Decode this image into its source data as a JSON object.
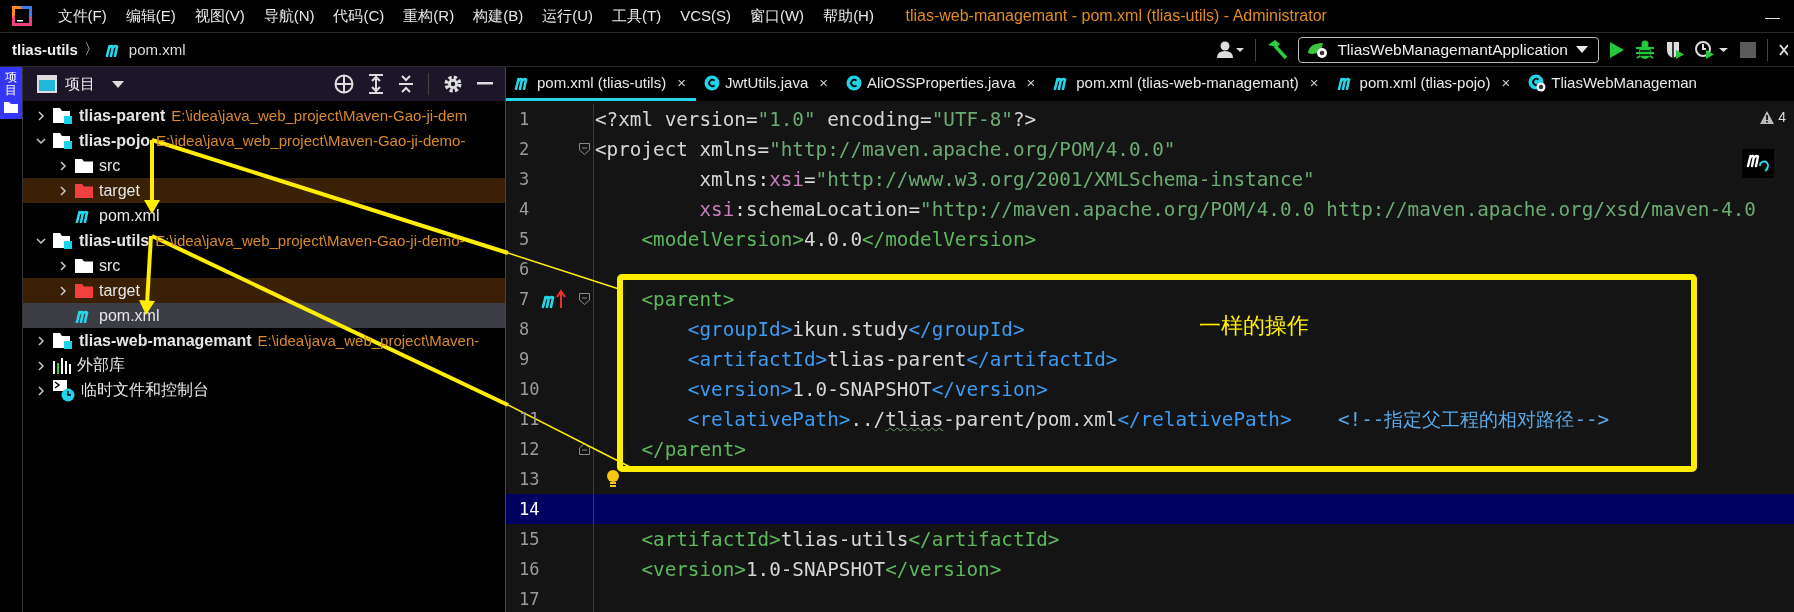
{
  "title_bar": {
    "menus": [
      "文件(F)",
      "编辑(E)",
      "视图(V)",
      "导航(N)",
      "代码(C)",
      "重构(R)",
      "构建(B)",
      "运行(U)",
      "工具(T)",
      "VCS(S)",
      "窗口(W)",
      "帮助(H)"
    ],
    "title": "tlias-web-managemant - pom.xml (tlias-utils) - Administrator",
    "minimize": "—"
  },
  "breadcrumb": {
    "project": "tlias-utils",
    "separator": "〉",
    "file": "pom.xml"
  },
  "toolbar": {
    "run_configuration": "TliasWebManagemantApplication"
  },
  "tool_strip": {
    "label": "项目",
    "selected": true
  },
  "project_panel": {
    "title": "项目",
    "tree": [
      {
        "name": "tlias-parent",
        "path": "E:\\idea\\java_web_project\\Maven-Gao-ji-dem",
        "kind": "module",
        "expanded": false,
        "selected": false
      },
      {
        "name": "tlias-pojo",
        "path": "E:\\idea\\java_web_project\\Maven-Gao-ji-demo-",
        "kind": "module",
        "expanded": true,
        "selected": false,
        "children": [
          {
            "name": "src",
            "kind": "folder",
            "expanded": false,
            "selected": false
          },
          {
            "name": "target",
            "kind": "excluded-folder",
            "expanded": false,
            "selected": false
          },
          {
            "name": "pom.xml",
            "kind": "pom",
            "selected": false
          }
        ]
      },
      {
        "name": "tlias-utils",
        "path": "E:\\idea\\java_web_project\\Maven-Gao-ji-demo-",
        "kind": "module",
        "expanded": true,
        "selected": false,
        "children": [
          {
            "name": "src",
            "kind": "folder",
            "expanded": false,
            "selected": false
          },
          {
            "name": "target",
            "kind": "excluded-folder",
            "expanded": false,
            "selected": false
          },
          {
            "name": "pom.xml",
            "kind": "pom",
            "selected": true
          }
        ]
      },
      {
        "name": "tlias-web-managemant",
        "path": "E:\\idea\\java_web_project\\Maven-",
        "kind": "module",
        "expanded": false,
        "selected": false
      },
      {
        "name": "外部库",
        "kind": "library",
        "expanded": false,
        "selected": false
      },
      {
        "name": "临时文件和控制台",
        "kind": "scratch",
        "expanded": false,
        "selected": false
      }
    ]
  },
  "editor": {
    "tabs": [
      {
        "label": "pom.xml (tlias-utils)",
        "kind": "maven",
        "selected": true,
        "close": "×"
      },
      {
        "label": "JwtUtils.java",
        "kind": "class",
        "selected": false,
        "close": "×"
      },
      {
        "label": "AliOSSProperties.java",
        "kind": "class",
        "selected": false,
        "close": "×"
      },
      {
        "label": "pom.xml (tlias-web-managemant)",
        "kind": "maven",
        "selected": false,
        "close": "×"
      },
      {
        "label": "pom.xml (tlias-pojo)",
        "kind": "maven",
        "selected": false,
        "close": "×"
      },
      {
        "label": "TliasWebManageman",
        "kind": "spring",
        "selected": false
      }
    ],
    "warnings": "4",
    "lines": [
      {
        "number": "1",
        "kind": "plain",
        "current": false,
        "tokens": [
          {
            "kind": "plain",
            "text": "<?xml version="
          },
          {
            "kind": "string",
            "text": "\"1.0\""
          },
          {
            "kind": "plain",
            "text": " encoding="
          },
          {
            "kind": "string",
            "text": "\"UTF-8\""
          },
          {
            "kind": "plain",
            "text": "?>"
          }
        ]
      },
      {
        "number": "2",
        "kind": "fold-start",
        "current": false,
        "tokens": [
          {
            "kind": "plain",
            "text": "<project xmlns="
          },
          {
            "kind": "string",
            "text": "\"http://maven.apache.org/POM/4.0.0\""
          }
        ]
      },
      {
        "number": "3",
        "kind": "plain",
        "current": false,
        "tokens": [
          {
            "kind": "plain",
            "text": "         xmlns:"
          },
          {
            "kind": "ns",
            "text": "xsi"
          },
          {
            "kind": "plain",
            "text": "="
          },
          {
            "kind": "string",
            "text": "\"http://www.w3.org/2001/XMLSchema-instance\""
          }
        ]
      },
      {
        "number": "4",
        "kind": "plain",
        "current": false,
        "tokens": [
          {
            "kind": "ns",
            "text": "         xsi"
          },
          {
            "kind": "plain",
            "text": ":schemaLocation="
          },
          {
            "kind": "string",
            "text": "\"http://maven.apache.org/POM/4.0.0 http://maven.apache.org/xsd/maven-4.0"
          }
        ]
      },
      {
        "number": "5",
        "kind": "plain",
        "current": false,
        "tokens": [
          {
            "kind": "tag",
            "text": "    <modelVersion>"
          },
          {
            "kind": "plain",
            "text": "4.0.0"
          },
          {
            "kind": "tag",
            "text": "</modelVersion>"
          }
        ]
      },
      {
        "number": "6",
        "kind": "plain",
        "current": false
      },
      {
        "number": "7",
        "kind": "maven-parent",
        "current": false,
        "tokens": [
          {
            "kind": "tag",
            "text": "    <parent>"
          }
        ]
      },
      {
        "number": "8",
        "kind": "plain",
        "current": false,
        "tokens": [
          {
            "kind": "tag-inner",
            "text": "        <groupId>"
          },
          {
            "kind": "plain",
            "text": "ikun.study"
          },
          {
            "kind": "tag-inner",
            "text": "</groupId>"
          }
        ]
      },
      {
        "number": "9",
        "kind": "plain",
        "current": false,
        "tokens": [
          {
            "kind": "tag-inner",
            "text": "        <artifactId>"
          },
          {
            "kind": "plain",
            "text": "tlias-parent"
          },
          {
            "kind": "tag-inner",
            "text": "</artifactId>"
          }
        ]
      },
      {
        "number": "10",
        "kind": "plain",
        "current": false,
        "tokens": [
          {
            "kind": "tag-inner",
            "text": "        <version>"
          },
          {
            "kind": "plain",
            "text": "1.0-SNAPSHOT"
          },
          {
            "kind": "tag-inner",
            "text": "</version>"
          }
        ]
      },
      {
        "number": "11",
        "kind": "plain",
        "current": false,
        "tokens": [
          {
            "kind": "tag-inner",
            "text": "        <relativePath>"
          },
          {
            "kind": "plain",
            "text": "../"
          },
          {
            "kind": "typo",
            "text": "tlias"
          },
          {
            "kind": "plain",
            "text": "-parent/pom.xml"
          },
          {
            "kind": "tag-inner",
            "text": "</relativePath>"
          },
          {
            "kind": "comment",
            "text": "    <!--指定父工程的相对路径-->"
          }
        ]
      },
      {
        "number": "12",
        "kind": "fold-end",
        "current": false,
        "tokens": [
          {
            "kind": "tag",
            "text": "    </parent>"
          }
        ]
      },
      {
        "number": "13",
        "kind": "bulb",
        "current": false
      },
      {
        "number": "14",
        "kind": "plain",
        "current": true
      },
      {
        "number": "15",
        "kind": "plain",
        "current": false,
        "tokens": [
          {
            "kind": "tag",
            "text": "    <artifactId>"
          },
          {
            "kind": "plain",
            "text": "tlias-utils"
          },
          {
            "kind": "tag",
            "text": "</artifactId>"
          }
        ]
      },
      {
        "number": "16",
        "kind": "plain",
        "current": false,
        "tokens": [
          {
            "kind": "tag",
            "text": "    <version>"
          },
          {
            "kind": "plain",
            "text": "1.0-SNAPSHOT"
          },
          {
            "kind": "tag",
            "text": "</version>"
          }
        ]
      },
      {
        "number": "17",
        "kind": "plain",
        "current": false
      }
    ]
  },
  "annotation": {
    "note": "一样的操作"
  }
}
